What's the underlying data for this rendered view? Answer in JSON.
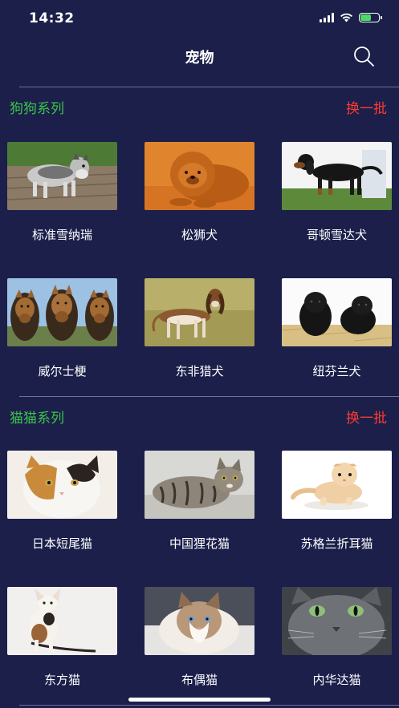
{
  "status": {
    "time": "14:32"
  },
  "nav": {
    "title": "宠物"
  },
  "sections": [
    {
      "title": "狗狗系列",
      "refresh_label": "换一批",
      "items": [
        {
          "label": "标准雪纳瑞",
          "photo": "schnauzer"
        },
        {
          "label": "松狮犬",
          "photo": "chow-chow"
        },
        {
          "label": "哥顿雪达犬",
          "photo": "gordon-setter"
        },
        {
          "label": "威尔士梗",
          "photo": "welsh-terriers"
        },
        {
          "label": "东非猎犬",
          "photo": "sloughi"
        },
        {
          "label": "纽芬兰犬",
          "photo": "newfoundland-puppies"
        }
      ]
    },
    {
      "title": "猫猫系列",
      "refresh_label": "换一批",
      "items": [
        {
          "label": "日本短尾猫",
          "photo": "japanese-bobtail"
        },
        {
          "label": "中国狸花猫",
          "photo": "dragon-li"
        },
        {
          "label": "苏格兰折耳猫",
          "photo": "scottish-fold"
        },
        {
          "label": "东方猫",
          "photo": "oriental-cat"
        },
        {
          "label": "布偶猫",
          "photo": "ragdoll"
        },
        {
          "label": "内华达猫",
          "photo": "nevada-cat"
        }
      ]
    }
  ],
  "colors": {
    "background": "#1b1f4a",
    "section_title": "#3cc44a",
    "refresh": "#ff3b30",
    "divider": "#6f7396"
  }
}
